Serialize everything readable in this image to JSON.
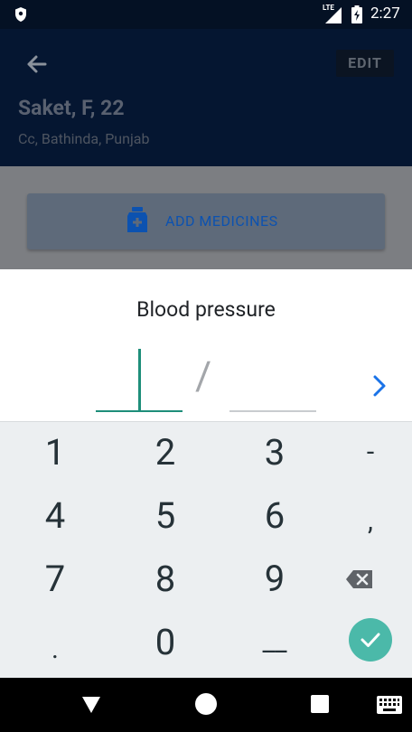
{
  "status_bar": {
    "time": "2:27",
    "network": "LTE",
    "icons": [
      "shield-icon",
      "signal-icon",
      "battery-charging-icon"
    ]
  },
  "header": {
    "back_icon": "arrow-back-icon",
    "edit_label": "EDIT",
    "patient_name": "Saket, F, 22",
    "patient_location": "Cc, Bathinda, Punjab"
  },
  "summary": {
    "add_medicines_label": "ADD MEDICINES",
    "add_medicines_icon": "medicine-add-icon"
  },
  "bp_sheet": {
    "title": "Blood pressure",
    "separator": "/",
    "systolic_value": "",
    "diastolic_value": "",
    "next_icon": "chevron-right-icon"
  },
  "keypad": {
    "row1": [
      "1",
      "2",
      "3",
      "-"
    ],
    "row2": [
      "4",
      "5",
      "6",
      ","
    ],
    "row3": [
      "7",
      "8",
      "9"
    ],
    "row4": [
      ".",
      "0",
      "__"
    ],
    "backspace_icon": "backspace-icon",
    "done_icon": "check-icon"
  },
  "nav_bar": {
    "icons": [
      "nav-back-icon",
      "nav-home-icon",
      "nav-recents-icon",
      "keyboard-icon"
    ]
  },
  "colors": {
    "header_bg": "#051631",
    "accent_teal": "#1e8e7a",
    "done_button": "#4bb9a9",
    "link_blue": "#1a73e8",
    "keyboard_bg": "#eceff1"
  }
}
